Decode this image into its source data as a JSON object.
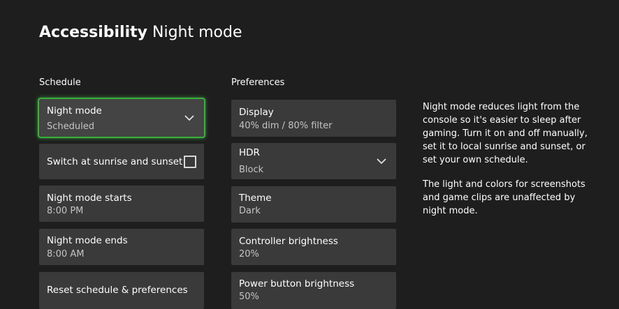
{
  "page": {
    "title_bold": "Accessibility",
    "title_rest": "Night mode"
  },
  "schedule": {
    "label": "Schedule",
    "night_mode": {
      "label": "Night mode",
      "value": "Scheduled"
    },
    "sunrise_sunset": {
      "label": "Switch at sunrise and sunset",
      "checked": false
    },
    "starts": {
      "label": "Night mode starts",
      "value": "8:00 PM"
    },
    "ends": {
      "label": "Night mode ends",
      "value": "8:00 AM"
    },
    "reset": {
      "label": "Reset schedule & preferences"
    }
  },
  "preferences": {
    "label": "Preferences",
    "display": {
      "label": "Display",
      "value": "40% dim / 80% filter"
    },
    "hdr": {
      "label": "HDR",
      "value": "Block"
    },
    "theme": {
      "label": "Theme",
      "value": "Dark"
    },
    "controller_brightness": {
      "label": "Controller brightness",
      "value": "20%"
    },
    "power_button_brightness": {
      "label": "Power button brightness",
      "value": "50%"
    }
  },
  "description": {
    "paragraph1": "Night mode reduces light from the console so it's easier to sleep after gaming. Turn it on and off manually, set it to local sunrise and sunset, or set your own schedule.",
    "paragraph2": "The light and colors for screenshots and game clips are unaffected by night mode."
  },
  "colors": {
    "background": "#1e1e1e",
    "tile": "#3a3a3a",
    "focus": "#39b139"
  }
}
